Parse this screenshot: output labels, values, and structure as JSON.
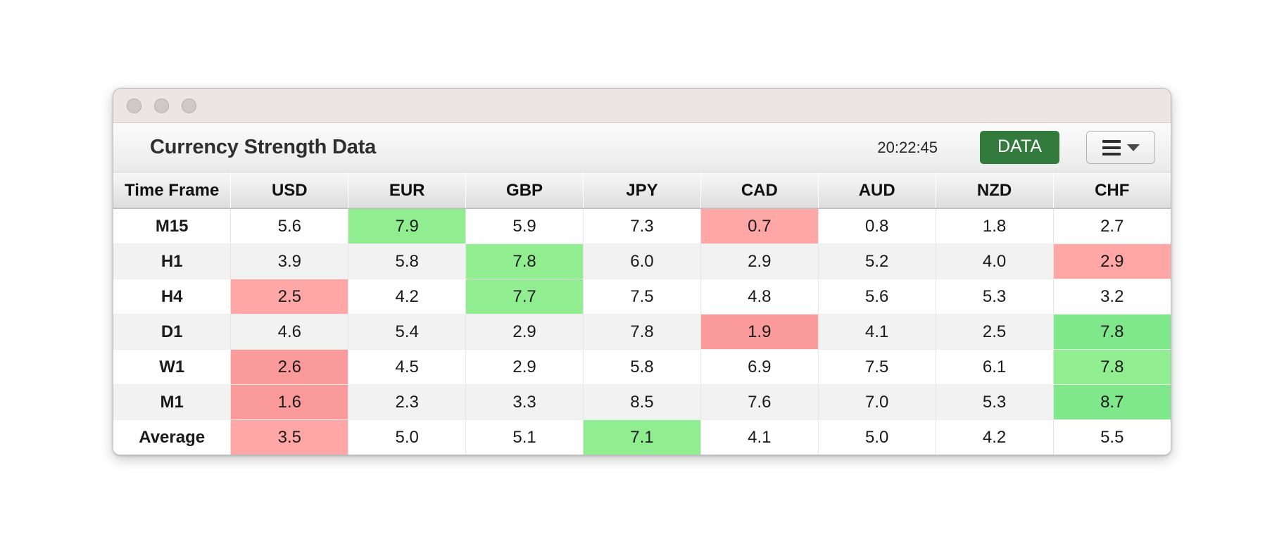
{
  "window": {
    "dots": [
      "close-dot",
      "minimize-dot",
      "zoom-dot"
    ]
  },
  "toolbar": {
    "title": "Currency Strength Data",
    "clock": "20:22:45",
    "data_button_label": "DATA",
    "data_button_color": "#337a3d",
    "menu_icon": "hamburger-icon",
    "caret_icon": "chevron-down-icon"
  },
  "table": {
    "columns": [
      "Time Frame",
      "USD",
      "EUR",
      "GBP",
      "JPY",
      "CAD",
      "AUD",
      "NZD",
      "CHF"
    ],
    "rows": [
      {
        "label": "M15",
        "cells": [
          {
            "value": "5.6",
            "hl": ""
          },
          {
            "value": "7.9",
            "hl": "hl-green"
          },
          {
            "value": "5.9",
            "hl": ""
          },
          {
            "value": "7.3",
            "hl": ""
          },
          {
            "value": "0.7",
            "hl": "hl-red"
          },
          {
            "value": "0.8",
            "hl": ""
          },
          {
            "value": "1.8",
            "hl": ""
          },
          {
            "value": "2.7",
            "hl": ""
          }
        ]
      },
      {
        "label": "H1",
        "cells": [
          {
            "value": "3.9",
            "hl": ""
          },
          {
            "value": "5.8",
            "hl": ""
          },
          {
            "value": "7.8",
            "hl": "hl-green"
          },
          {
            "value": "6.0",
            "hl": ""
          },
          {
            "value": "2.9",
            "hl": ""
          },
          {
            "value": "5.2",
            "hl": ""
          },
          {
            "value": "4.0",
            "hl": ""
          },
          {
            "value": "2.9",
            "hl": "hl-red"
          }
        ]
      },
      {
        "label": "H4",
        "cells": [
          {
            "value": "2.5",
            "hl": "hl-red"
          },
          {
            "value": "4.2",
            "hl": ""
          },
          {
            "value": "7.7",
            "hl": "hl-green"
          },
          {
            "value": "7.5",
            "hl": ""
          },
          {
            "value": "4.8",
            "hl": ""
          },
          {
            "value": "5.6",
            "hl": ""
          },
          {
            "value": "5.3",
            "hl": ""
          },
          {
            "value": "3.2",
            "hl": ""
          }
        ]
      },
      {
        "label": "D1",
        "cells": [
          {
            "value": "4.6",
            "hl": ""
          },
          {
            "value": "5.4",
            "hl": ""
          },
          {
            "value": "2.9",
            "hl": ""
          },
          {
            "value": "7.8",
            "hl": ""
          },
          {
            "value": "1.9",
            "hl": "hl-red-strong"
          },
          {
            "value": "4.1",
            "hl": ""
          },
          {
            "value": "2.5",
            "hl": ""
          },
          {
            "value": "7.8",
            "hl": "hl-green-strong"
          }
        ]
      },
      {
        "label": "W1",
        "cells": [
          {
            "value": "2.6",
            "hl": "hl-red-strong"
          },
          {
            "value": "4.5",
            "hl": ""
          },
          {
            "value": "2.9",
            "hl": ""
          },
          {
            "value": "5.8",
            "hl": ""
          },
          {
            "value": "6.9",
            "hl": ""
          },
          {
            "value": "7.5",
            "hl": ""
          },
          {
            "value": "6.1",
            "hl": ""
          },
          {
            "value": "7.8",
            "hl": "hl-green"
          }
        ]
      },
      {
        "label": "M1",
        "cells": [
          {
            "value": "1.6",
            "hl": "hl-red-strong"
          },
          {
            "value": "2.3",
            "hl": ""
          },
          {
            "value": "3.3",
            "hl": ""
          },
          {
            "value": "8.5",
            "hl": ""
          },
          {
            "value": "7.6",
            "hl": ""
          },
          {
            "value": "7.0",
            "hl": ""
          },
          {
            "value": "5.3",
            "hl": ""
          },
          {
            "value": "8.7",
            "hl": "hl-green-strong"
          }
        ]
      },
      {
        "label": "Average",
        "cells": [
          {
            "value": "3.5",
            "hl": "hl-red"
          },
          {
            "value": "5.0",
            "hl": ""
          },
          {
            "value": "5.1",
            "hl": ""
          },
          {
            "value": "7.1",
            "hl": "hl-green"
          },
          {
            "value": "4.1",
            "hl": ""
          },
          {
            "value": "5.0",
            "hl": ""
          },
          {
            "value": "4.2",
            "hl": ""
          },
          {
            "value": "5.5",
            "hl": ""
          }
        ]
      }
    ]
  }
}
